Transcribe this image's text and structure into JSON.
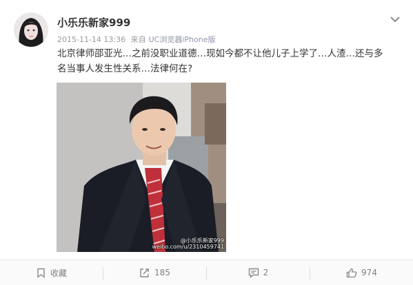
{
  "post": {
    "username": "小乐乐新家999",
    "timestamp": "2015-11-14 13:36",
    "source_prefix": "来自",
    "source": "UC浏览器iPhone版",
    "text_line1": "北京律师邵亚光…之前没职业道德…现如今都不让他儿子上学了…人渣…还与多",
    "text_line2": "名当事人发生性关系…法律何在?",
    "watermark_name": "@小乐乐新家999",
    "watermark_url": "weibo.com/u/2310459741"
  },
  "icons": {
    "avatar": "avatar",
    "menu": "chevron-down-icon",
    "favorite": "bookmark-icon",
    "repost": "repost-icon",
    "comment": "comment-icon",
    "like": "thumbs-up-icon"
  },
  "actions": {
    "favorite_label": "收藏",
    "repost_count": "185",
    "comment_count": "2",
    "like_count": "974"
  }
}
